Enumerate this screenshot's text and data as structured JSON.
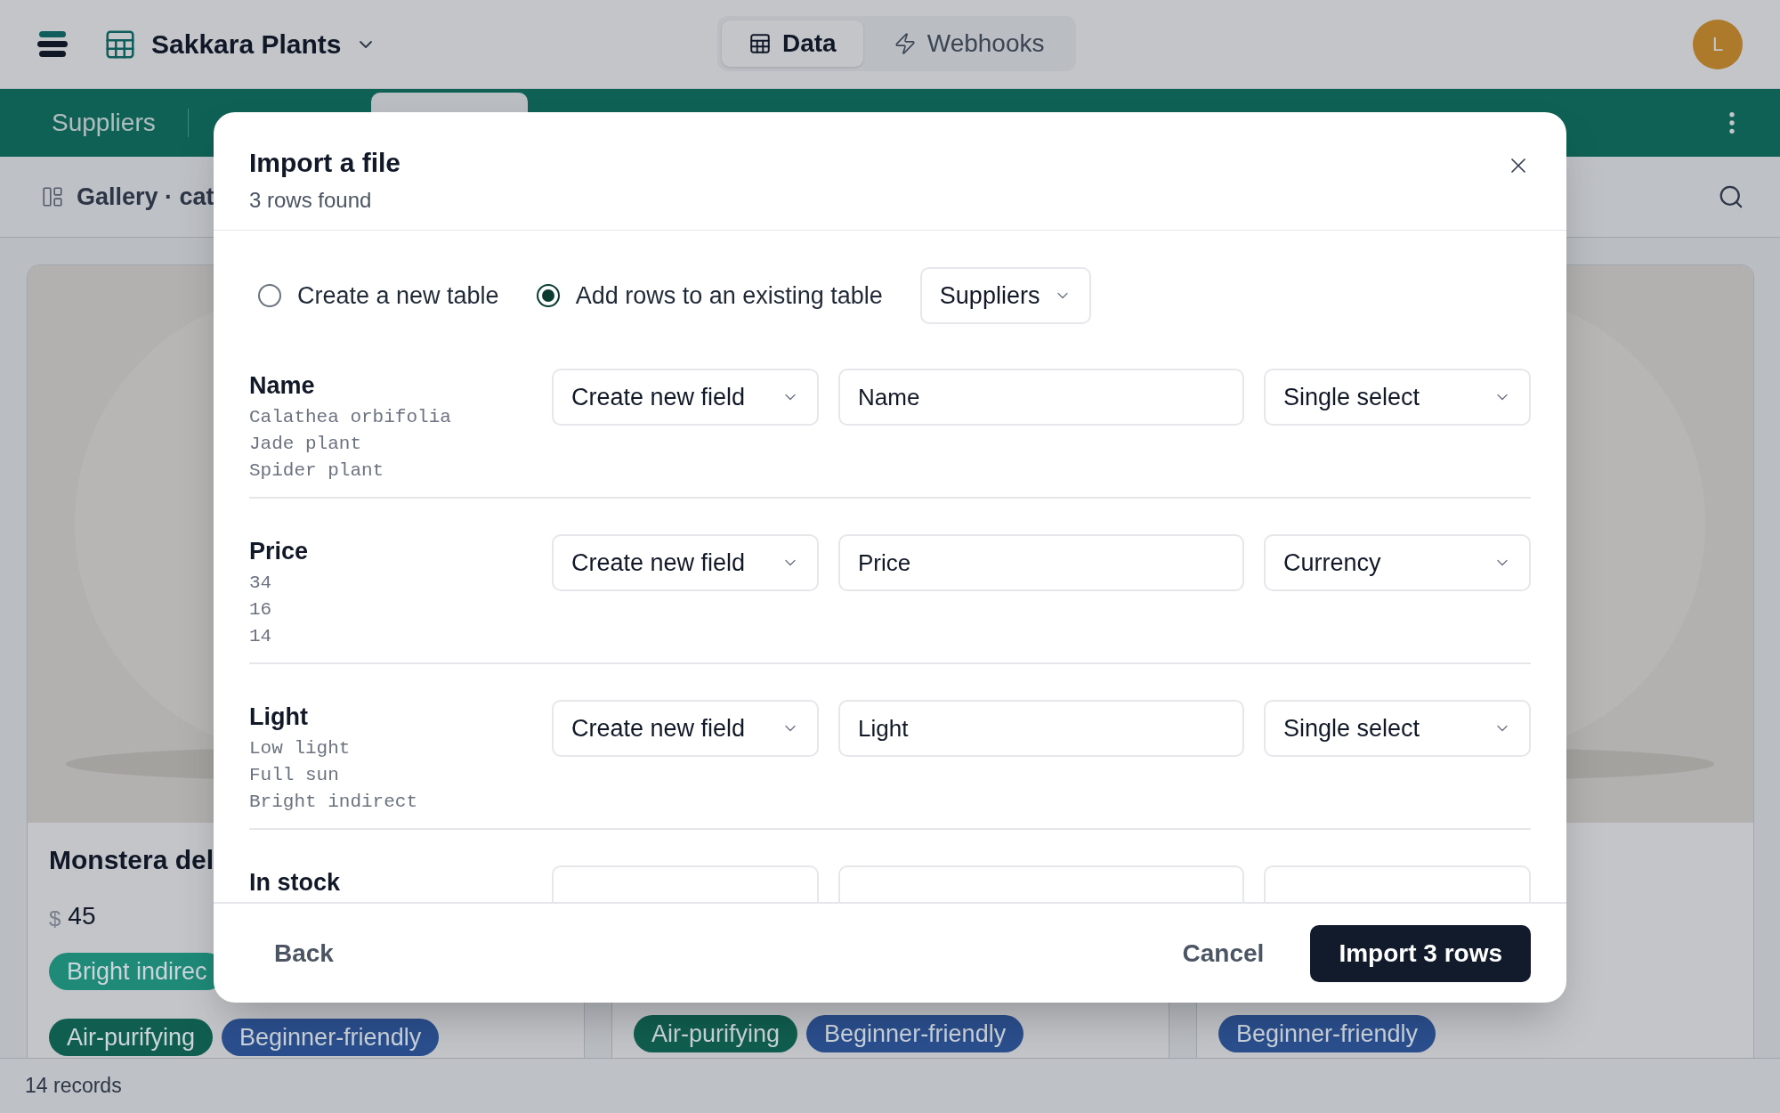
{
  "app_bar": {
    "title": "Sakkara Plants",
    "tabs": [
      {
        "label": "Data",
        "selected": true
      },
      {
        "label": "Webhooks",
        "selected": false
      }
    ],
    "avatar": "L"
  },
  "table_tabs": [
    {
      "label": "Suppliers"
    }
  ],
  "view": {
    "title": "Gallery · cat"
  },
  "cards": [
    {
      "image": {
        "kind": "picture"
      },
      "title": "Monstera del",
      "currency": "$",
      "price": "45",
      "tag_rows": [
        [
          {
            "label": "Bright indirec",
            "color": "#1f8a78"
          }
        ],
        [
          {
            "label": "Air-purifying",
            "color": "#105e4f"
          },
          {
            "label": "Beginner-friendly",
            "color": "#2b4f8e"
          }
        ]
      ]
    },
    {
      "tag_rows": [
        [
          {
            "label": "Air-purifying",
            "color": "#105e4f"
          },
          {
            "label": "Beginner-friendly",
            "color": "#2b4f8e"
          }
        ]
      ]
    },
    {
      "image": {
        "kind": "picture"
      },
      "tag_rows": [
        [
          {
            "label": "Beginner-friendly",
            "color": "#2b4f8e"
          }
        ]
      ]
    }
  ],
  "footer": {
    "count": "14 records"
  },
  "dialog": {
    "title": "Import a file",
    "subtitle": "3 rows found",
    "modes": [
      {
        "label": "Create a new table",
        "selected": false
      },
      {
        "label": "Add rows to an existing table",
        "selected": true
      }
    ],
    "target_table": "Suppliers",
    "fields": [
      {
        "name": "Name",
        "samples": [
          "Calathea orbifolia",
          "Jade plant",
          "Spider plant"
        ],
        "action": "Create new field",
        "field_name": "Name",
        "type": "Single select"
      },
      {
        "name": "Price",
        "samples": [
          "34",
          "16",
          "14"
        ],
        "action": "Create new field",
        "field_name": "Price",
        "type": "Currency"
      },
      {
        "name": "Light",
        "samples": [
          "Low light",
          "Full sun",
          "Bright indirect"
        ],
        "action": "Create new field",
        "field_name": "Light",
        "type": "Single select"
      },
      {
        "name": "In stock"
      }
    ],
    "back": "Back",
    "cancel": "Cancel",
    "confirm": "Import 3 rows"
  }
}
